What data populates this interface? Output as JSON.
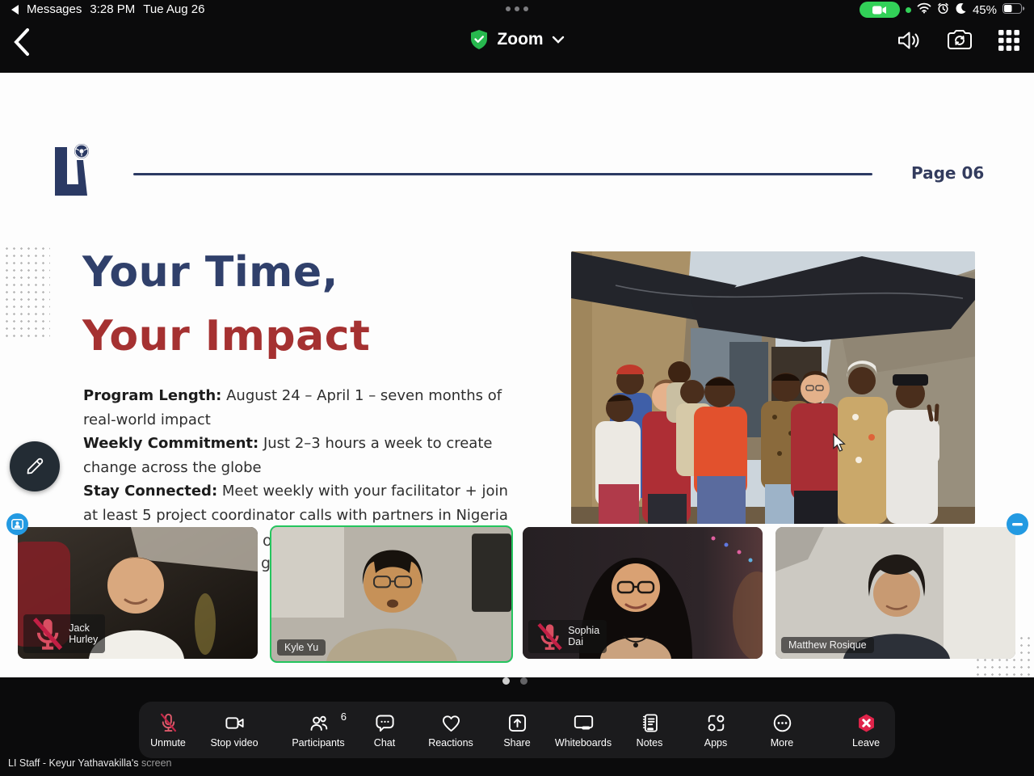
{
  "status_bar": {
    "back_app": "Messages",
    "time": "3:28 PM",
    "date": "Tue Aug 26",
    "battery_percent": "45%"
  },
  "nav_bar": {
    "title": "Zoom"
  },
  "slide": {
    "page_label": "Page 06",
    "title_line1": "Your Time,",
    "title_line2": "Your Impact",
    "bullets": [
      {
        "label": "Program Length:",
        "text": " August 24 – April 1 – seven months of real-world impact"
      },
      {
        "label": "Weekly Commitment:",
        "text": " Just 2–3 hours a week to create change across the globe"
      },
      {
        "label": "Stay Connected:",
        "text": " Meet weekly with your facilitator + join at least 5 project coordinator calls with partners in Nigeria"
      }
    ],
    "obscured_fragments": [
      "o",
      "gr"
    ]
  },
  "participants": [
    {
      "name": "Jack Hurley",
      "muted": true,
      "active_speaker": false
    },
    {
      "name": "Kyle Yu",
      "muted": false,
      "active_speaker": true
    },
    {
      "name": "Sophia Dai",
      "muted": true,
      "active_speaker": false
    },
    {
      "name": "Matthew Rosique",
      "muted": false,
      "active_speaker": false
    }
  ],
  "pagination": {
    "dot_count": 2,
    "active_index": 0
  },
  "toolbar": {
    "unmute": "Unmute",
    "stop_video": "Stop video",
    "participants": "Participants",
    "participants_count": "6",
    "chat": "Chat",
    "reactions": "Reactions",
    "share": "Share",
    "whiteboards": "Whiteboards",
    "notes": "Notes",
    "apps": "Apps",
    "more": "More",
    "leave": "Leave"
  },
  "footer": {
    "sharing_text": "LI Staff - Keyur Yathavakilla's",
    "sharing_suffix": " screen"
  },
  "colors": {
    "active_speaker_green": "#24c55e",
    "zoom_shield_green": "#27b84e",
    "leave_red": "#e0244a",
    "muted_mic_red": "#d94f62",
    "title_navy": "#30406b",
    "title_red": "#a53131",
    "edge_button_blue": "#239ae2"
  }
}
